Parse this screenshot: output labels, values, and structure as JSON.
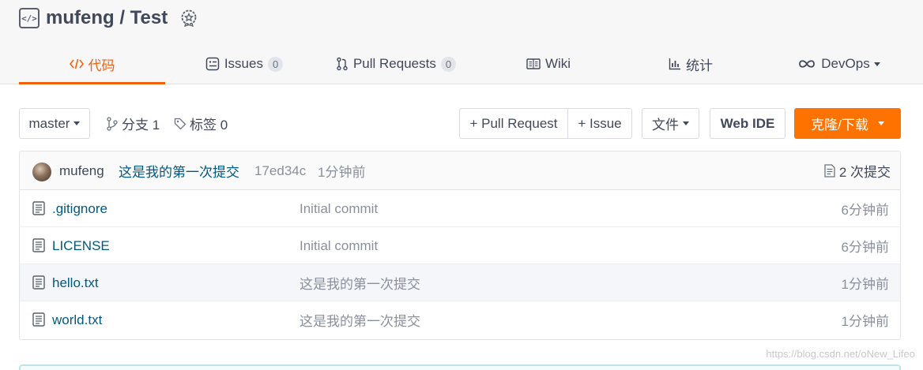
{
  "repo": {
    "title": "mufeng / Test"
  },
  "tabs": [
    {
      "label": "代码",
      "icon": "code-icon"
    },
    {
      "label": "Issues",
      "count": "0",
      "icon": "issues-icon"
    },
    {
      "label": "Pull Requests",
      "count": "0",
      "icon": "pull-request-icon"
    },
    {
      "label": "Wiki",
      "icon": "wiki-icon"
    },
    {
      "label": "统计",
      "icon": "stats-icon"
    },
    {
      "label": "DevOps",
      "icon": "devops-icon"
    }
  ],
  "toolbar": {
    "branch": "master",
    "branches": "分支 1",
    "tags": "标签 0",
    "new_pr": "+ Pull Request",
    "new_issue": "+ Issue",
    "file_menu": "文件",
    "web_ide": "Web IDE",
    "clone": "克隆/下载"
  },
  "latest_commit": {
    "author": "mufeng",
    "message": "这是我的第一次提交",
    "hash": "17ed34c",
    "time": "1分钟前",
    "count": "2 次提交"
  },
  "files": [
    {
      "name": ".gitignore",
      "commit": "Initial commit",
      "time": "6分钟前"
    },
    {
      "name": "LICENSE",
      "commit": "Initial commit",
      "time": "6分钟前"
    },
    {
      "name": "hello.txt",
      "commit": "这是我的第一次提交",
      "time": "1分钟前"
    },
    {
      "name": "world.txt",
      "commit": "这是我的第一次提交",
      "time": "1分钟前"
    }
  ],
  "watermark": "https://blog.csdn.net/oNew_Lifeo",
  "colors": {
    "accent": "#f0620a",
    "primary_button": "#fe7300",
    "link": "#005980"
  }
}
